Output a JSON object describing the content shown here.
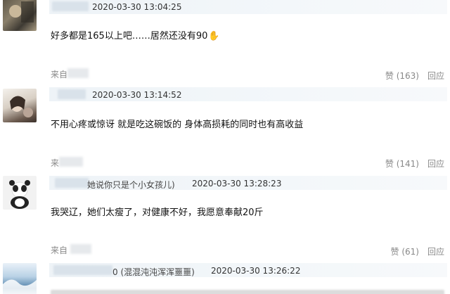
{
  "comments": [
    {
      "timestamp": "2020-03-30 13:04:25",
      "text": "好多都是165以上吧……居然还没有90",
      "emoji_icon": "waving-hand-icon",
      "from_label": "来自",
      "like_label": "赞 (163)",
      "reply_label": "回应"
    },
    {
      "timestamp": "2020-03-30 13:14:52",
      "text": "不用心疼或惊讶 就是吃这碗饭的 身体高损耗的同时也有高收益",
      "from_label": "来",
      "like_label": "赞 (141)",
      "reply_label": "回应"
    },
    {
      "nick_suffix": "她说你只是个小女孩儿)",
      "timestamp": "2020-03-30 13:28:23",
      "text": "我哭辽，她们太瘦了，对健康不好，我愿意奉献20斤",
      "from_label": "来自",
      "like_label": "赞 (61)",
      "reply_label": "回应"
    },
    {
      "nick_suffix": "0 (混混沌沌浑浑噩噩)",
      "timestamp": "2020-03-30 13:26:22"
    }
  ],
  "colors": {
    "bar": "#eef3f7",
    "muted": "#888888",
    "emoji": "#e8a10c"
  }
}
